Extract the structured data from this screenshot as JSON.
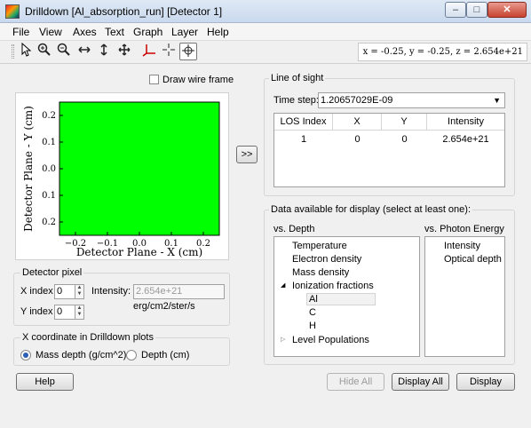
{
  "window": {
    "title": "Drilldown [Al_absorption_run] [Detector 1]",
    "min_glyph": "–",
    "max_glyph": "□",
    "close_glyph": "✕"
  },
  "menu": [
    "File",
    "View",
    "Axes",
    "Text",
    "Graph",
    "Layer",
    "Help"
  ],
  "toolbar": {
    "tools": [
      "pointer-icon",
      "zoom-in-icon",
      "zoom-out-icon",
      "pan-horizontal-icon",
      "pan-vertical-icon",
      "pan-all-icon",
      "axes-tool-icon",
      "crosshair-icon",
      "target-icon"
    ],
    "coordinates": "x = -0.25, y = -0.25,  z = 2.654e+21"
  },
  "wire_frame_label": "Draw wire frame",
  "plot": {
    "xlabel": "Detector Plane - X (cm)",
    "ylabel": "Detector Plane - Y (cm)",
    "fill_color": "#00ff00"
  },
  "chart_data": {
    "type": "heatmap",
    "title": "",
    "xlabel": "Detector Plane - X (cm)",
    "ylabel": "Detector Plane - Y (cm)",
    "x_ticks": [
      "−0.2",
      "−0.1",
      "0.0",
      "0.1",
      "0.2"
    ],
    "y_ticks": [
      "0.2",
      "0.1",
      "0.0",
      "0.1",
      "0.2"
    ],
    "xlim": [
      -0.25,
      0.25
    ],
    "ylim": [
      -0.25,
      0.25
    ],
    "cells": [
      {
        "x": 0,
        "y": 0,
        "value": 2.654e+21
      }
    ],
    "color": "#00ff00"
  },
  "detector_pixel": {
    "title": "Detector pixel",
    "x_label": "X index",
    "x_value": "0",
    "y_label": "Y index",
    "y_value": "0",
    "intensity_label": "Intensity:",
    "intensity_value": "2.654e+21",
    "intensity_unit": "erg/cm2/ster/s"
  },
  "x_coordinate": {
    "title": "X coordinate in Drilldown plots",
    "options": [
      "Mass depth (g/cm^2)",
      "Depth (cm)"
    ],
    "selected": 0
  },
  "transfer_button": ">>",
  "line_of_sight": {
    "title": "Line of sight",
    "time_step_label": "Time step:",
    "time_step_value": "1.20657029E-09",
    "columns": [
      "LOS Index",
      "X",
      "Y",
      "Intensity"
    ],
    "rows": [
      [
        "1",
        "0",
        "0",
        "2.654e+21"
      ]
    ]
  },
  "data_available": {
    "title": "Data available for display (select at least one):",
    "vs_depth_label": "vs. Depth",
    "vs_depth_items": [
      "Temperature",
      "Electron density",
      "Mass density"
    ],
    "ionization_label": "Ionization fractions",
    "ionization_children": [
      "Al",
      "C",
      "H"
    ],
    "level_populations_label": "Level Populations",
    "vs_photon_label": "vs. Photon Energy",
    "vs_photon_items": [
      "Intensity",
      "Optical depth"
    ]
  },
  "buttons": {
    "help": "Help",
    "hide_all": "Hide All",
    "display_all": "Display All",
    "display": "Display"
  }
}
